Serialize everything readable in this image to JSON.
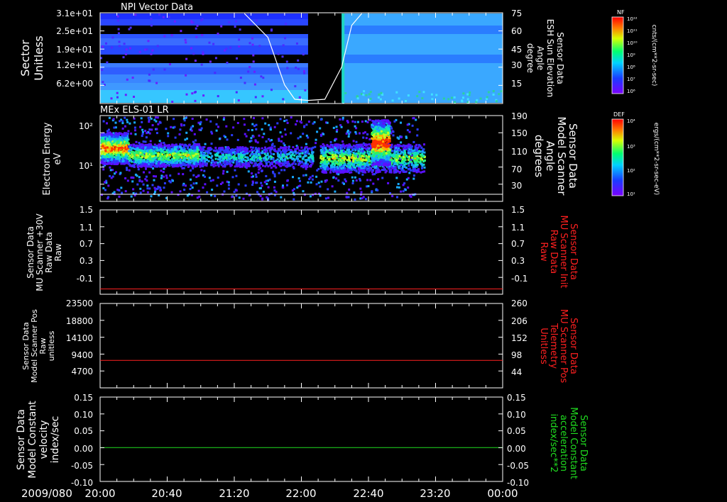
{
  "date_label": "2009/080",
  "time_ticks": [
    "20:00",
    "20:40",
    "21:20",
    "22:00",
    "22:40",
    "23:20",
    "00:00"
  ],
  "colors": {
    "background": "#000000",
    "axis": "#ffffff",
    "red_trace": "#ff2020",
    "green_trace": "#20dd20",
    "white_trace": "#ffffff"
  },
  "panels": {
    "p1": {
      "title": "NPI Vector Data",
      "left_label": [
        "Sector",
        "Unitless"
      ],
      "left_ticks": [
        "3.1e+01",
        "2.5e+01",
        "1.9e+01",
        "1.2e+01",
        "6.2e+00"
      ],
      "right_label": [
        "Sensor Data",
        "ESH Sun Elevation",
        "Angle",
        "degree"
      ],
      "right_ticks": [
        "75",
        "60",
        "45",
        "30",
        "15"
      ],
      "colorbar": {
        "tag": "NF",
        "units": "cnts/(cm**2-sr-sec)",
        "ticks": [
          "10¹²",
          "10¹¹",
          "10¹⁰",
          "10⁹",
          "10⁸",
          "10⁷",
          "10⁶"
        ]
      }
    },
    "p2": {
      "title": "MEx ELS-01 LR",
      "left_label": [
        "Electron Energy",
        "eV"
      ],
      "left_ticks": [
        "10²",
        "10¹"
      ],
      "right_label": [
        "Sensor Data",
        "Model Scanner",
        "Angle",
        "degrees"
      ],
      "right_ticks": [
        "190",
        "150",
        "110",
        "70",
        "30"
      ],
      "colorbar": {
        "tag": "DEF",
        "units": "ergs/(cm**2-sr-sec-eV)",
        "ticks": [
          "10⁴",
          "10³",
          "10²",
          "10¹"
        ]
      }
    },
    "p3": {
      "left_label": [
        "Sensor Data",
        "MU Scanner +30V",
        "Raw Data",
        "Raw"
      ],
      "left_ticks": [
        "1.5",
        "1.1",
        "0.7",
        "0.3",
        "-0.1"
      ],
      "right_label": [
        "Sensor Data",
        "MU Scanner Init",
        "Raw Data",
        "Raw"
      ],
      "right_ticks": [
        "1.5",
        "1.1",
        "0.7",
        "0.3",
        "-0.1"
      ]
    },
    "p4": {
      "left_label": [
        "Sensor Data",
        "Model Scanner Pos",
        "Raw",
        "unitless"
      ],
      "left_ticks": [
        "23500",
        "18800",
        "14100",
        "9400",
        "4700"
      ],
      "right_label": [
        "Sensor Data",
        "MU Scanner Pos",
        "Telemetry",
        "Unitless"
      ],
      "right_ticks": [
        "260",
        "206",
        "152",
        "98",
        "44"
      ]
    },
    "p5": {
      "left_label": [
        "Sensor Data",
        "Model Constant",
        "velocity",
        "index/sec"
      ],
      "left_ticks": [
        "0.15",
        "0.10",
        "0.05",
        "0.00",
        "-0.05",
        "-0.10"
      ],
      "right_label": [
        "Sensor Data",
        "Model Constant",
        "acceleration",
        "index/sec**2"
      ],
      "right_ticks": [
        "0.15",
        "0.10",
        "0.05",
        "0.00",
        "-0.05",
        "-0.10"
      ]
    }
  },
  "chart_data": [
    {
      "type": "heatmap",
      "title": "NPI Vector Data",
      "x_range": [
        "20:00",
        "00:00"
      ],
      "ylabel": "Sector Unitless",
      "y_ticks": [
        31,
        25,
        19,
        12,
        6.2
      ],
      "data_gap": [
        "22:04",
        "22:24"
      ],
      "overlay_line": {
        "name": "ESH Sun Elevation Angle",
        "axis": "right",
        "ylim": [
          0,
          75
        ],
        "x": [
          "21:26",
          "21:40",
          "21:50",
          "21:56",
          "22:04",
          "22:14",
          "22:24",
          "22:30",
          "22:36"
        ],
        "y": [
          75,
          55,
          15,
          3,
          2,
          3,
          30,
          65,
          75
        ]
      }
    },
    {
      "type": "heatmap",
      "title": "MEx ELS-01 LR",
      "x_range": [
        "20:00",
        "00:00"
      ],
      "ylabel": "Electron Energy eV",
      "y_scale": "log",
      "data_end": "23:10",
      "overlay_line": {
        "name": "Model Scanner Angle",
        "axis": "right",
        "ylim": [
          0,
          190
        ],
        "constant": 0
      }
    },
    {
      "type": "line",
      "x_range": [
        "20:00",
        "00:00"
      ],
      "ylim": [
        -0.3,
        1.5
      ],
      "series": [
        {
          "name": "",
          "color": "#ff2020",
          "constant": -0.2
        }
      ]
    },
    {
      "type": "line",
      "x_range": [
        "20:00",
        "00:00"
      ],
      "ylim": [
        0,
        23500
      ],
      "series": [
        {
          "name": "",
          "color": "#ff2020",
          "constant": 7600
        }
      ]
    },
    {
      "type": "line",
      "x_range": [
        "20:00",
        "00:00"
      ],
      "ylim": [
        -0.1,
        0.15
      ],
      "series": [
        {
          "name": "",
          "color": "#20dd20",
          "constant": 0.0
        }
      ]
    }
  ]
}
